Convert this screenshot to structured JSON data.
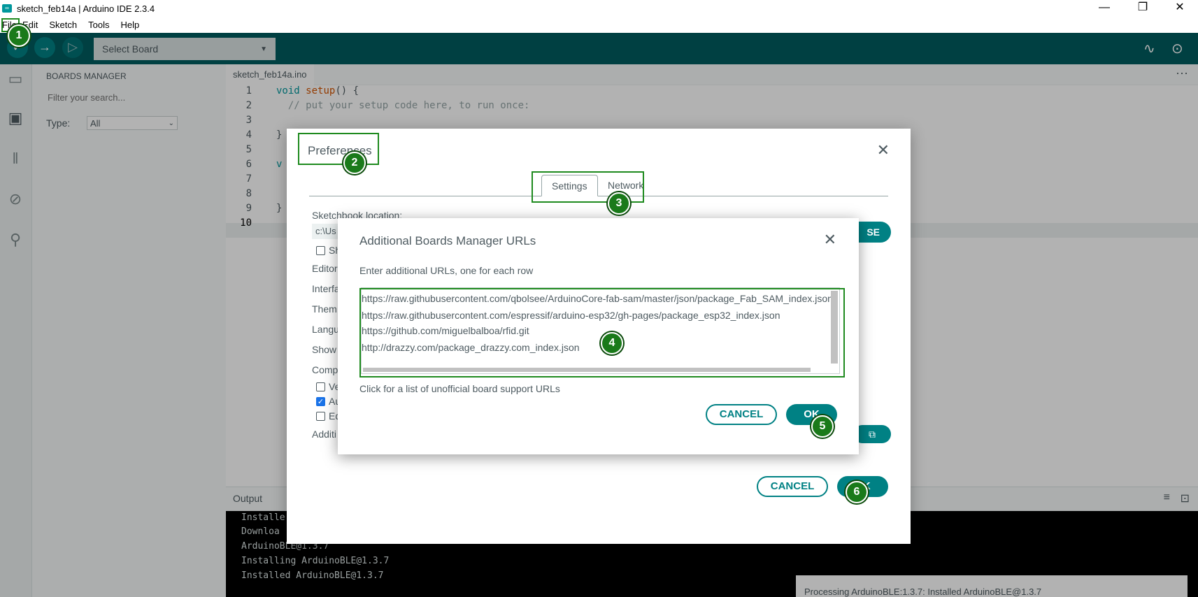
{
  "window": {
    "title": "sketch_feb14a | Arduino IDE 2.3.4",
    "minimize": "—",
    "maximize": "❐",
    "close": "✕"
  },
  "menu": {
    "items": [
      "File",
      "Edit",
      "Sketch",
      "Tools",
      "Help"
    ]
  },
  "toolbar": {
    "verify_icon": "check-icon",
    "upload_icon": "arrow-right-icon",
    "debug_icon": "debug-icon",
    "board_select": "Select Board",
    "serial_plotter_icon": "plotter-icon",
    "serial_monitor_icon": "monitor-icon",
    "accent": "#005c5f"
  },
  "sidebar": {
    "title": "BOARDS MANAGER",
    "filter_placeholder": "Filter your search...",
    "type_label": "Type:",
    "type_value": "All"
  },
  "editor": {
    "tab": "sketch_feb14a.ino",
    "line_numbers": [
      "1",
      "2",
      "3",
      "4",
      "5",
      "6",
      "7",
      "8",
      "9",
      "10"
    ],
    "line1_kw": "void",
    "line1_fn": "setup",
    "line1_rest": "() {",
    "line2": "  // put your setup code here, to run once:",
    "line4": "}",
    "line6": "v"
  },
  "output": {
    "tab": "Output",
    "lines": [
      "Installe",
      "Downloa",
      "ArduinoBLE@1.3.7",
      "Installing ArduinoBLE@1.3.7",
      "Installed ArduinoBLE@1.3.7"
    ],
    "notification": "Processing ArduinoBLE:1.3.7: Installed ArduinoBLE@1.3.7"
  },
  "preferences": {
    "title": "Preferences",
    "close": "✕",
    "tabs": [
      "Settings",
      "Network"
    ],
    "sketchbook_label": "Sketchbook location:",
    "sketchbook_value": "c:\\Us",
    "browse": "SE",
    "labels": [
      "Sh",
      "Editor",
      "Interfa",
      "Them",
      "Langu",
      "Show",
      "Comp"
    ],
    "checks": [
      "Ve",
      "Au",
      "Ed"
    ],
    "additional_label": "Additi",
    "cancel": "CANCEL",
    "ok": "OK"
  },
  "urls_dialog": {
    "title": "Additional Boards Manager URLs",
    "close": "✕",
    "hint": "Enter additional URLs, one for each row",
    "urls": [
      "https://raw.githubusercontent.com/qbolsee/ArduinoCore-fab-sam/master/json/package_Fab_SAM_index.json",
      "https://raw.githubusercontent.com/espressif/arduino-esp32/gh-pages/package_esp32_index.json",
      " https://github.com/miguelbalboa/rfid.git",
      " http://drazzy.com/package_drazzy.com_index.json"
    ],
    "link": "Click for a list of unofficial board support URLs",
    "cancel": "CANCEL",
    "ok": "OK"
  },
  "annotations": [
    "1",
    "2",
    "3",
    "4",
    "5",
    "6"
  ]
}
